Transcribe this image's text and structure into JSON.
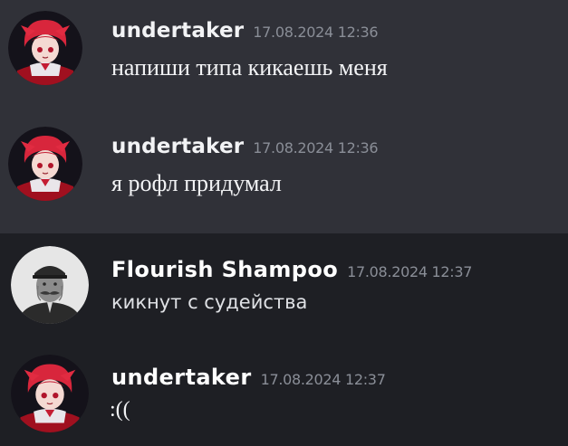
{
  "messages": [
    {
      "author": "undertaker",
      "timestamp": "17.08.2024 12:36",
      "text": "напиши типа кикаешь меня",
      "avatar_icon": "anime-girl-avatar-icon"
    },
    {
      "author": "undertaker",
      "timestamp": "17.08.2024 12:36",
      "text": "я рофл придумал",
      "avatar_icon": "anime-girl-avatar-icon"
    },
    {
      "author": "Flourish Shampoo",
      "timestamp": "17.08.2024 12:37",
      "text": "кикнут с судейства",
      "avatar_icon": "vintage-portrait-avatar-icon"
    },
    {
      "author": "undertaker",
      "timestamp": "17.08.2024 12:37",
      "text": ":((",
      "avatar_icon": "anime-girl-avatar-icon"
    }
  ],
  "colors": {
    "highlighted_background": "#303138",
    "chat_background": "#1e1f24",
    "author_color": "#f2f3f5",
    "timestamp_color": "#8a8e97",
    "avatar_accent": "#d8263c"
  }
}
